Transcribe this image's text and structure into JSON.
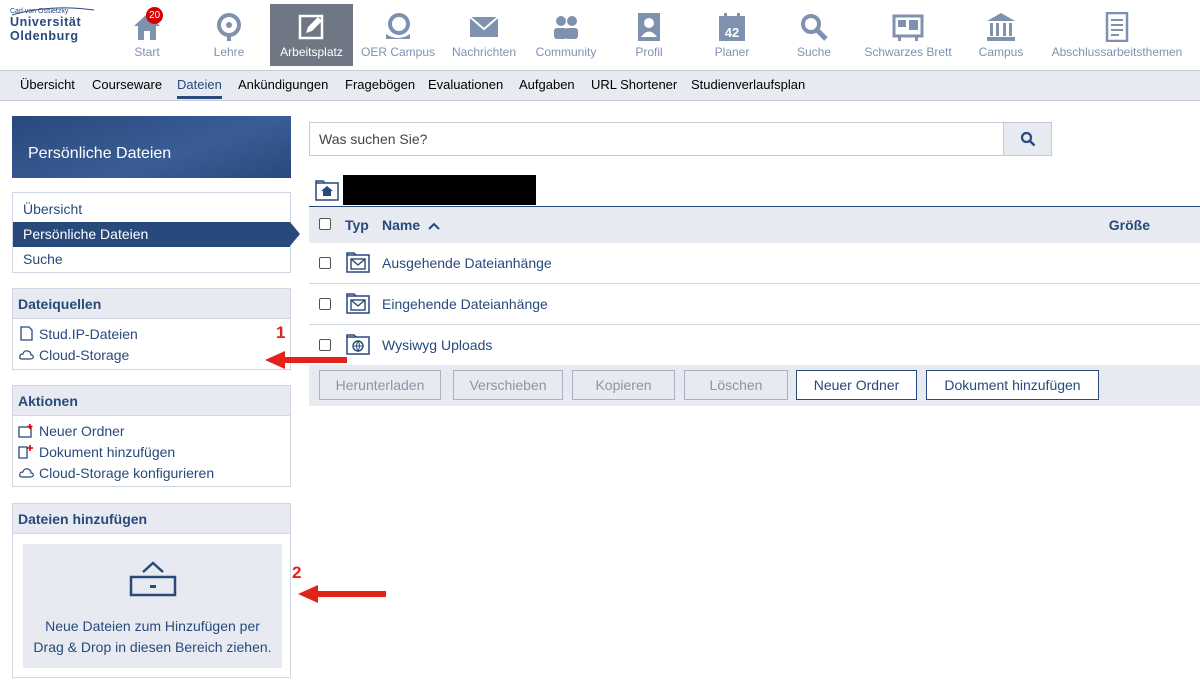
{
  "logo": {
    "line1": "Carl von Ossietzky",
    "line2": "Universität",
    "line3": "Oldenburg"
  },
  "topnav": [
    {
      "label": "Start",
      "icon": "home-icon",
      "badge": "20"
    },
    {
      "label": "Lehre",
      "icon": "lecture-icon"
    },
    {
      "label": "Arbeitsplatz",
      "icon": "workspace-icon",
      "active": true
    },
    {
      "label": "OER Campus",
      "icon": "oer-icon"
    },
    {
      "label": "Nachrichten",
      "icon": "mail-icon"
    },
    {
      "label": "Community",
      "icon": "community-icon"
    },
    {
      "label": "Profil",
      "icon": "profile-icon"
    },
    {
      "label": "Planer",
      "icon": "calendar-icon",
      "icon_text": "42"
    },
    {
      "label": "Suche",
      "icon": "search-icon"
    },
    {
      "label": "Schwarzes Brett",
      "icon": "board-icon"
    },
    {
      "label": "Campus",
      "icon": "campus-icon"
    },
    {
      "label": "Abschlussarbeitsthemen",
      "icon": "thesis-icon"
    }
  ],
  "subnav": [
    {
      "label": "Übersicht"
    },
    {
      "label": "Courseware"
    },
    {
      "label": "Dateien",
      "active": true
    },
    {
      "label": "Ankündigungen"
    },
    {
      "label": "Fragebögen"
    },
    {
      "label": "Evaluationen"
    },
    {
      "label": "Aufgaben"
    },
    {
      "label": "URL Shortener"
    },
    {
      "label": "Studienverlaufsplan"
    }
  ],
  "sidebar": {
    "header": "Persönliche Dateien",
    "nav": [
      {
        "label": "Übersicht"
      },
      {
        "label": "Persönliche Dateien",
        "selected": true
      },
      {
        "label": "Suche"
      }
    ],
    "sources": {
      "title": "Dateiquellen",
      "items": [
        {
          "label": "Stud.IP-Dateien",
          "icon": "document-icon"
        },
        {
          "label": "Cloud-Storage",
          "icon": "cloud-icon"
        }
      ]
    },
    "actions": {
      "title": "Aktionen",
      "items": [
        {
          "label": "Neuer Ordner",
          "icon": "folder-add-icon"
        },
        {
          "label": "Dokument hinzufügen",
          "icon": "document-add-icon"
        },
        {
          "label": "Cloud-Storage konfigurieren",
          "icon": "cloud-icon"
        }
      ]
    },
    "upload": {
      "title": "Dateien hinzufügen",
      "text_line1": "Neue Dateien zum Hinzufügen per",
      "text_line2": "Drag & Drop in diesen Bereich ziehen."
    }
  },
  "search": {
    "placeholder": "Was suchen Sie?"
  },
  "table": {
    "headers": {
      "type": "Typ",
      "name": "Name",
      "size": "Größe"
    },
    "rows": [
      {
        "name": "Ausgehende Dateianhänge",
        "icon": "folder-mail-outgoing-icon"
      },
      {
        "name": "Eingehende Dateianhänge",
        "icon": "folder-mail-incoming-icon"
      },
      {
        "name": "Wysiwyg Uploads",
        "icon": "folder-globe-icon"
      }
    ]
  },
  "buttons": [
    {
      "label": "Herunterladen",
      "disabled": true
    },
    {
      "label": "Verschieben",
      "disabled": true
    },
    {
      "label": "Kopieren",
      "disabled": true
    },
    {
      "label": "Löschen",
      "disabled": true
    },
    {
      "label": "Neuer Ordner",
      "disabled": false
    },
    {
      "label": "Dokument hinzufügen",
      "disabled": false
    }
  ],
  "annotations": {
    "n1": "1",
    "n2": "2"
  },
  "colors": {
    "brand": "#28497c",
    "light": "#e7ebf1",
    "active_nav": "#6f7784",
    "badge": "#d60000",
    "annotation": "#e2231a"
  }
}
